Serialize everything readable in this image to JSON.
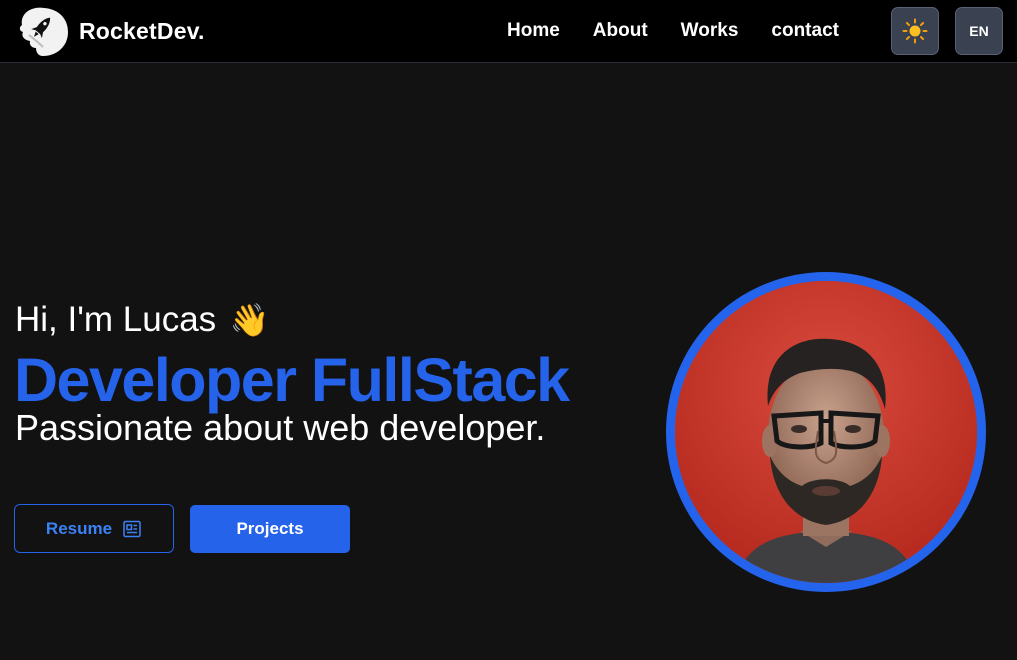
{
  "header": {
    "brand_name": "RocketDev.",
    "nav": [
      {
        "label": "Home"
      },
      {
        "label": "About"
      },
      {
        "label": "Works"
      },
      {
        "label": "contact"
      }
    ],
    "theme_icon": "sun-icon",
    "language": "EN"
  },
  "hero": {
    "greeting": "Hi, I'm Lucas",
    "wave_emoji": "👋",
    "role": "Developer FullStack",
    "tagline": "Passionate about web developer.",
    "buttons": {
      "resume": "Resume",
      "resume_icon": "newspaper-icon",
      "projects": "Projects"
    }
  },
  "colors": {
    "accent": "#2563eb",
    "background": "#121212",
    "navbar": "#000000"
  }
}
